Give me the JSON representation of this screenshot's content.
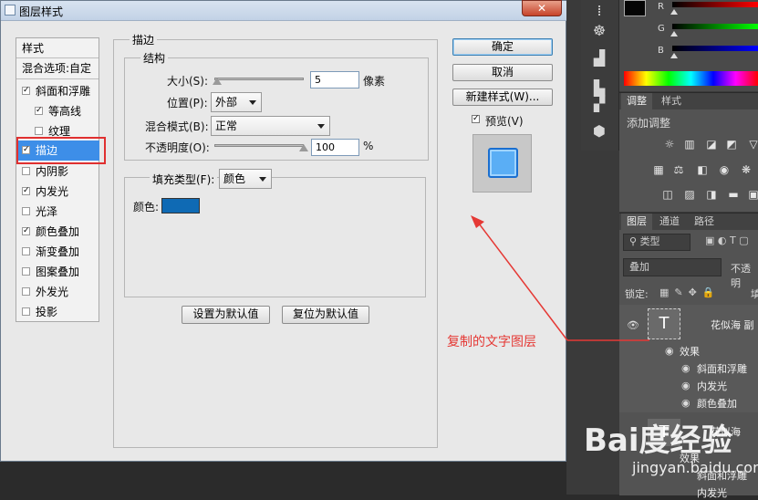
{
  "dialog": {
    "title": "图层样式",
    "close_label": "✕",
    "styles_header": "样式",
    "blend_options": "混合选项:自定",
    "style_items": [
      {
        "label": "斜面和浮雕",
        "checked": true
      },
      {
        "label": "等高线",
        "checked": true
      },
      {
        "label": "纹理",
        "checked": false
      },
      {
        "label": "描边",
        "checked": true
      },
      {
        "label": "内阴影",
        "checked": false
      },
      {
        "label": "内发光",
        "checked": true
      },
      {
        "label": "光泽",
        "checked": false
      },
      {
        "label": "颜色叠加",
        "checked": true
      },
      {
        "label": "渐变叠加",
        "checked": false
      },
      {
        "label": "图案叠加",
        "checked": false
      },
      {
        "label": "外发光",
        "checked": false
      },
      {
        "label": "投影",
        "checked": false
      }
    ],
    "stroke": {
      "section_title": "描边",
      "structure_title": "结构",
      "size_label": "大小(S):",
      "size_value": "5",
      "size_unit": "像素",
      "position_label": "位置(P):",
      "position_value": "外部",
      "blend_mode_label": "混合模式(B):",
      "blend_mode_value": "正常",
      "opacity_label": "不透明度(O):",
      "opacity_value": "100",
      "opacity_unit": "%",
      "fill_type_label": "填充类型(F):",
      "fill_type_value": "颜色",
      "color_label": "颜色:",
      "color_hex": "#0f6ab4",
      "set_default_btn": "设置为默认值",
      "reset_default_btn": "复位为默认值"
    },
    "buttons": {
      "ok": "确定",
      "cancel": "取消",
      "new_style": "新建样式(W)...",
      "preview_label": "预览(V)",
      "preview_checked": true
    }
  },
  "ps": {
    "color_panel": {
      "r": "R",
      "g": "G",
      "b": "B"
    },
    "adjust_tabs": [
      "调整",
      "样式"
    ],
    "adjust_title": "添加调整",
    "layer_tabs": [
      "图层",
      "通道",
      "路径"
    ],
    "filter_type": "类型",
    "blend_mode": "叠加",
    "opacity_short": "不透明",
    "lock_label": "锁定:",
    "fill_short": "填",
    "layer1_name": "花似海 副",
    "layer2_name": "花似海",
    "effects_label": "效果",
    "layer1_effects": [
      "斜面和浮雕",
      "内发光",
      "颜色叠加"
    ],
    "layer2_effects": [
      "斜面和浮雕",
      "内发光"
    ]
  },
  "annotation": {
    "text": "复制的文字图层"
  },
  "watermark": {
    "main": "Bai度经验",
    "sub": "jingyan.baidu.com"
  }
}
